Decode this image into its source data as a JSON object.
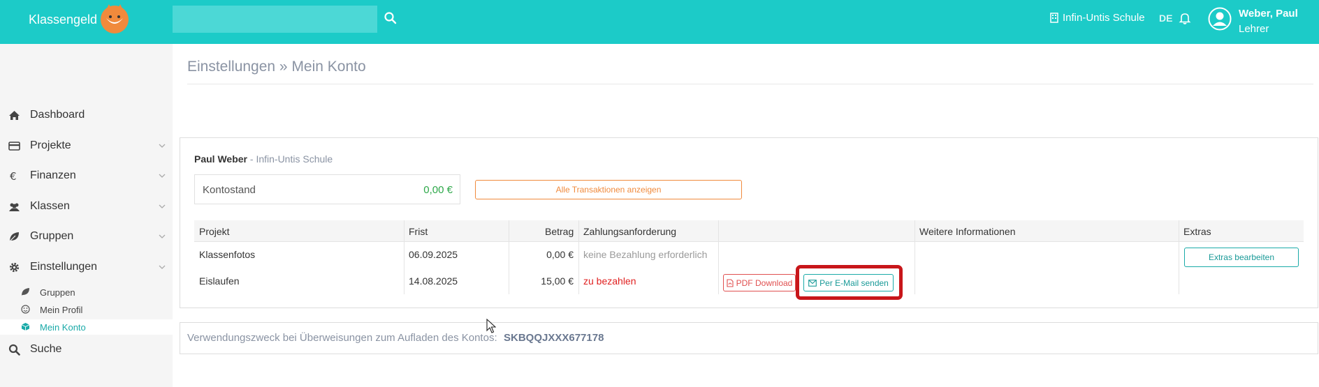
{
  "header": {
    "brand": "Klassengeld",
    "search": {
      "value": "",
      "placeholder": ""
    },
    "school": "Infin-Untis Schule",
    "language": "DE",
    "user": {
      "name": "Weber, Paul",
      "role": "Lehrer"
    }
  },
  "sidebar": {
    "items": [
      {
        "label": "Dashboard",
        "icon": "home-icon"
      },
      {
        "label": "Projekte",
        "icon": "credit-card-icon"
      },
      {
        "label": "Finanzen",
        "icon": "euro-icon"
      },
      {
        "label": "Klassen",
        "icon": "users-icon"
      },
      {
        "label": "Gruppen",
        "icon": "leaf-icon"
      },
      {
        "label": "Einstellungen",
        "icon": "gear-icon"
      },
      {
        "label": "Suche",
        "icon": "search-icon"
      }
    ],
    "subitems": [
      {
        "label": "Gruppen",
        "icon": "leaf-icon"
      },
      {
        "label": "Mein Profil",
        "icon": "smiley-icon"
      },
      {
        "label": "Mein Konto",
        "icon": "cube-icon",
        "active": true
      }
    ]
  },
  "page": {
    "title": "Einstellungen » Mein Konto",
    "owner_name": "Paul Weber",
    "owner_school": " - Infin-Untis Schule",
    "balance_label": "Kontostand",
    "balance_value": "0,00 €",
    "all_transactions": "Alle Transaktionen anzeigen"
  },
  "table": {
    "headers": [
      "Projekt",
      "Frist",
      "Betrag",
      "Zahlungsanforderung",
      "",
      "Weitere Informationen",
      "Extras"
    ],
    "rows": [
      {
        "project": "Klassenfotos",
        "due": "06.09.2025",
        "amount": "0,00 €",
        "status": "keine Bezahlung erforderlich"
      },
      {
        "project": "Eislaufen",
        "due": "14.08.2025",
        "amount": "15,00 €",
        "status": "zu bezahlen"
      }
    ],
    "pdf_label": "PDF Download",
    "mail_label": "Per E-Mail senden",
    "extras_label": "Extras bearbeiten"
  },
  "reference": {
    "label": "Verwendungszweck bei Überweisungen zum Aufladen des Kontos:",
    "code": "SKBQQJXXX677178"
  },
  "colors": {
    "accent": "#1ccbc8",
    "highlight": "#c8161a",
    "warning": "#f08a3c",
    "danger": "#e02020",
    "success": "#2ea84a"
  }
}
